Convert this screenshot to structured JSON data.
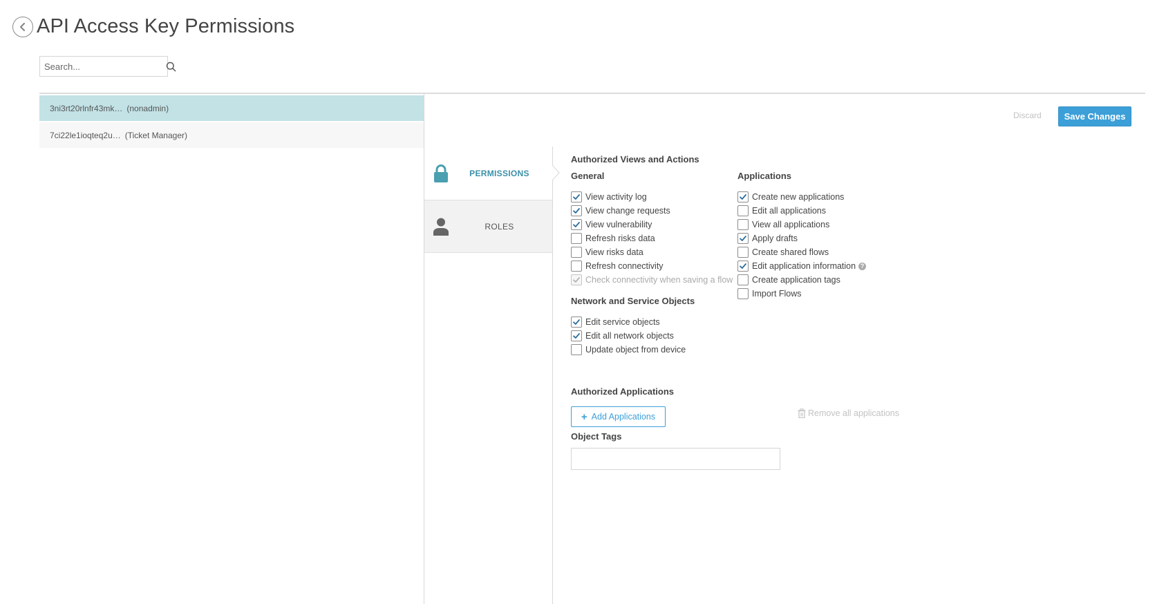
{
  "header": {
    "title": "API Access Key Permissions",
    "back_icon": "chevron-left-icon"
  },
  "search": {
    "placeholder": "Search...",
    "icon": "search-icon"
  },
  "keys": [
    {
      "id": "3ni3rt20rlnfr43mk…",
      "role": "(nonadmin)",
      "selected": true
    },
    {
      "id": "7ci22le1ioqteq2u…",
      "role": "(Ticket Manager)",
      "selected": false
    }
  ],
  "actions": {
    "discard_label": "Discard",
    "save_label": "Save Changes"
  },
  "tabs": {
    "permissions": {
      "label": "PERMISSIONS",
      "icon": "lock-icon",
      "active": true
    },
    "roles": {
      "label": "ROLES",
      "icon": "user-icon",
      "active": false
    }
  },
  "permissions": {
    "title": "Authorized Views and Actions",
    "general": {
      "title": "General",
      "items": [
        {
          "label": "View activity log",
          "checked": true
        },
        {
          "label": "View change requests",
          "checked": true
        },
        {
          "label": "View vulnerability",
          "checked": true
        },
        {
          "label": "Refresh risks data",
          "checked": false
        },
        {
          "label": "View risks data",
          "checked": false
        },
        {
          "label": "Refresh connectivity",
          "checked": false
        },
        {
          "label": "Check connectivity when saving a flow",
          "checked": true,
          "disabled": true
        }
      ]
    },
    "network": {
      "title": "Network and Service Objects",
      "items": [
        {
          "label": "Edit service objects",
          "checked": true
        },
        {
          "label": "Edit all network objects",
          "checked": true
        },
        {
          "label": "Update object from device",
          "checked": false
        }
      ]
    },
    "applications": {
      "title": "Applications",
      "items": [
        {
          "label": "Create new applications",
          "checked": true
        },
        {
          "label": "Edit all applications",
          "checked": false
        },
        {
          "label": "View all applications",
          "checked": false
        },
        {
          "label": "Apply drafts",
          "checked": true
        },
        {
          "label": "Create shared flows",
          "checked": false
        },
        {
          "label": "Edit application information",
          "checked": true,
          "help": true
        },
        {
          "label": "Create application tags",
          "checked": false
        },
        {
          "label": "Import Flows",
          "checked": false
        }
      ]
    }
  },
  "authorized_applications": {
    "title": "Authorized Applications",
    "add_label": "Add Applications",
    "remove_all_label": "Remove all applications"
  },
  "object_tags": {
    "title": "Object Tags",
    "value": ""
  },
  "colors": {
    "accent": "#3c9fd8",
    "selected_row": "#c2e2e6",
    "tab_active_text": "#3a8fa8",
    "lock_icon": "#4a9fb0",
    "user_icon": "#666666"
  }
}
